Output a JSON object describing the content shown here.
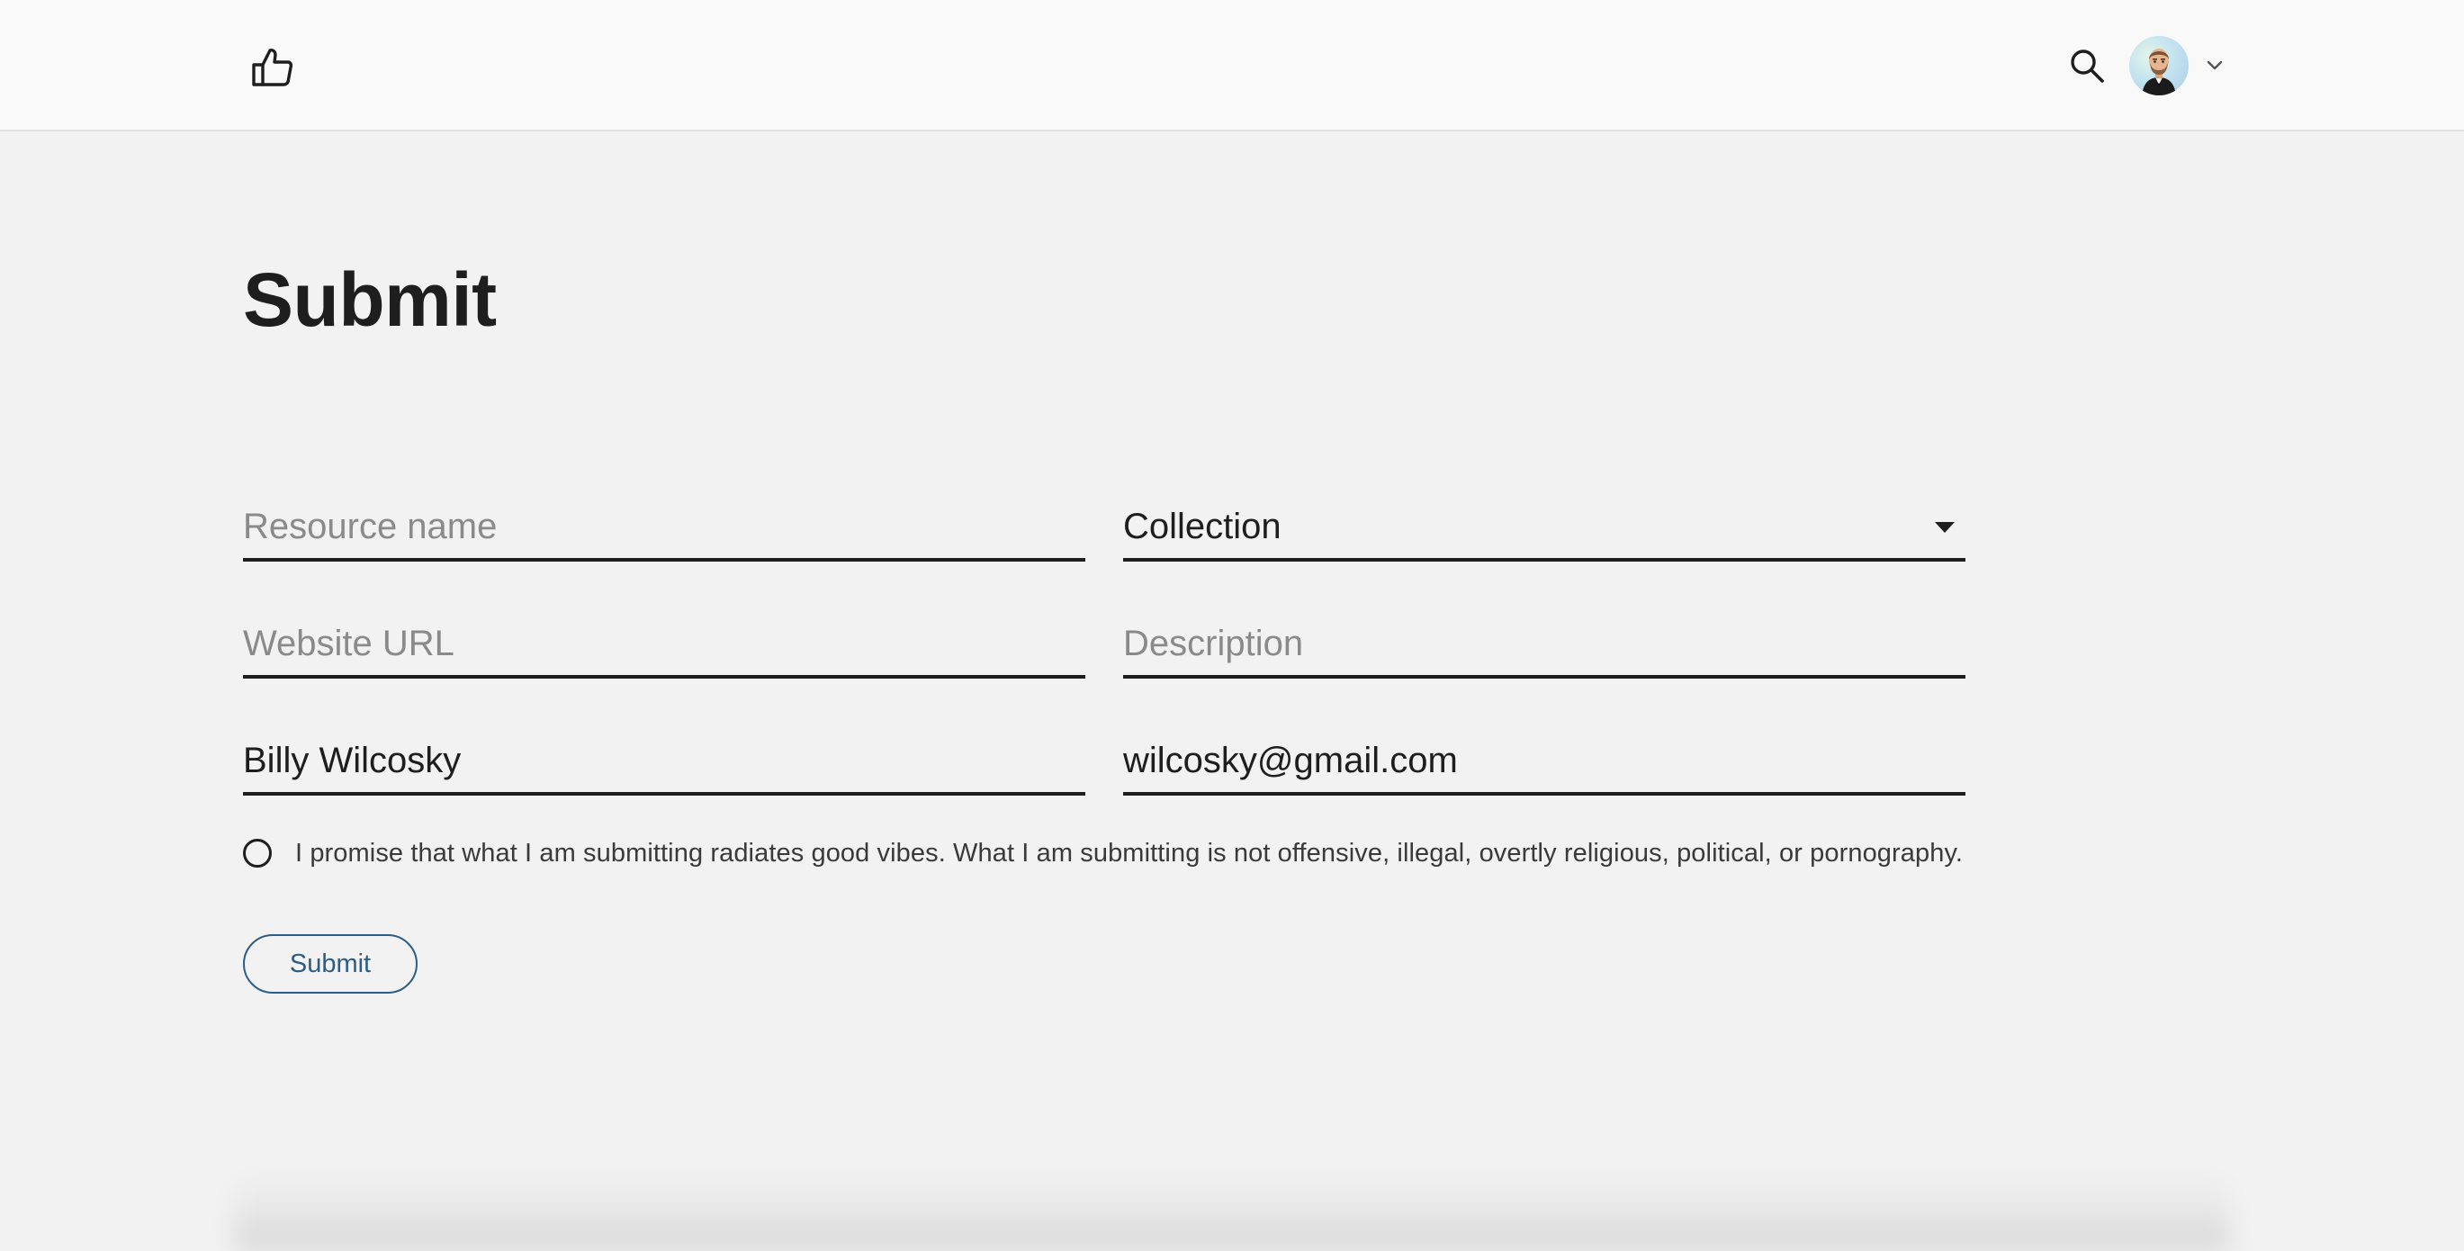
{
  "header": {
    "logo_icon": "thumbs-up-icon",
    "search_icon": "search-icon",
    "avatar_icon": "user-avatar",
    "menu_icon": "chevron-down-icon"
  },
  "page": {
    "title": "Submit"
  },
  "form": {
    "resource_name": {
      "placeholder": "Resource name",
      "value": ""
    },
    "collection": {
      "value": "Collection"
    },
    "website_url": {
      "placeholder": "Website URL",
      "value": ""
    },
    "description": {
      "placeholder": "Description",
      "value": ""
    },
    "name": {
      "placeholder": "",
      "value": "Billy Wilcosky"
    },
    "email": {
      "placeholder": "",
      "value": "wilcosky@gmail.com"
    },
    "consent_text": "I promise that what I am submitting radiates good vibes. What I am submitting is not offensive, illegal, overtly religious, political, or pornography.",
    "submit_label": "Submit"
  },
  "colors": {
    "accent": "#2c5d86",
    "text": "#1e1e1e",
    "background": "#f2f2f2",
    "topbar": "#f9f9f9"
  }
}
